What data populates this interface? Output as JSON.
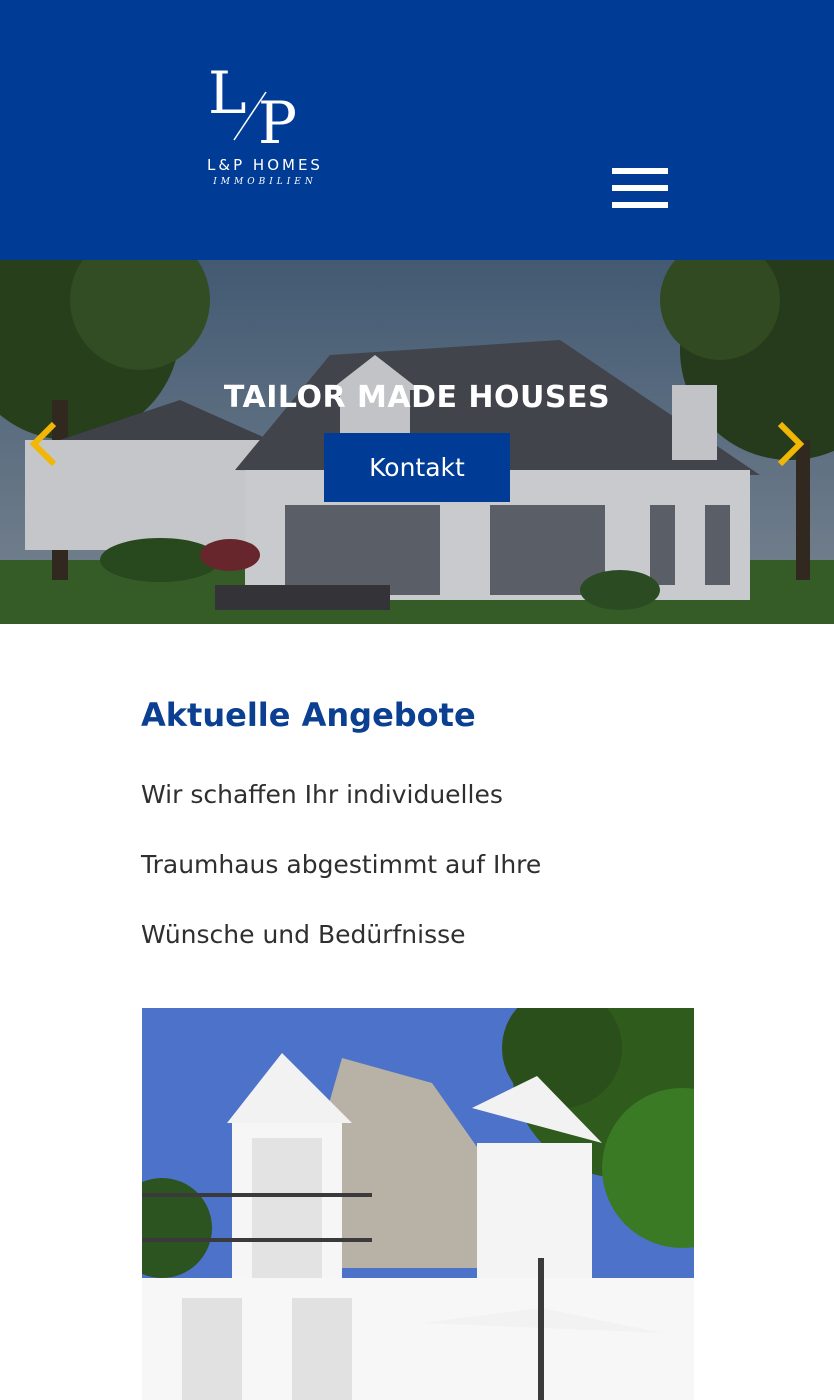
{
  "header": {
    "logo_monogram": "L/P",
    "logo_brand": "L&P HOMES",
    "logo_subtitle": "IMMOBILIEN",
    "menu_icon": "hamburger-icon",
    "background": "#003c96"
  },
  "hero": {
    "title": "TAILOR MADE HOUSES",
    "cta_label": "Kontakt",
    "prev_icon": "chevron-left-icon",
    "next_icon": "chevron-right-icon",
    "arrow_color": "#f2b705"
  },
  "offers": {
    "title": "Aktuelle Angebote",
    "lines": [
      "Wir schaffen Ihr individuelles",
      "Traumhaus abgestimmt auf Ihre",
      "Wünsche und Bedürfnisse"
    ],
    "accent": "#0a3f91"
  }
}
